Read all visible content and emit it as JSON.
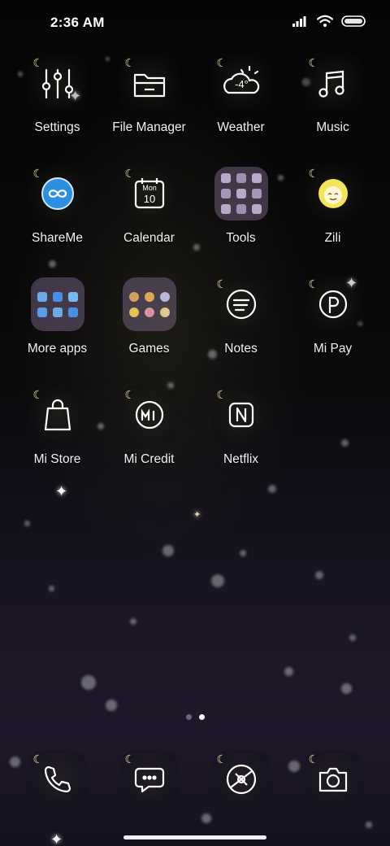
{
  "status_bar": {
    "time": "2:36 AM",
    "icons": [
      "signal-icon",
      "wifi-icon",
      "battery-icon"
    ]
  },
  "apps": [
    {
      "label": "Settings",
      "icon": "settings-sliders-icon"
    },
    {
      "label": "File Manager",
      "icon": "folder-icon"
    },
    {
      "label": "Weather",
      "icon": "weather-cloud-icon",
      "temp": "-4°"
    },
    {
      "label": "Music",
      "icon": "music-note-icon"
    },
    {
      "label": "ShareMe",
      "icon": "infinity-icon"
    },
    {
      "label": "Calendar",
      "icon": "calendar-icon",
      "day": "Mon",
      "date": "10"
    },
    {
      "label": "Tools",
      "icon": "folder-grid-icon"
    },
    {
      "label": "Zili",
      "icon": "zili-face-icon"
    },
    {
      "label": "More apps",
      "icon": "folder-grid-icon"
    },
    {
      "label": "Games",
      "icon": "folder-grid-icon"
    },
    {
      "label": "Notes",
      "icon": "notes-icon"
    },
    {
      "label": "Mi Pay",
      "icon": "mi-pay-icon"
    },
    {
      "label": "Mi Store",
      "icon": "shopping-bag-icon"
    },
    {
      "label": "Mi Credit",
      "icon": "mi-credit-icon"
    },
    {
      "label": "Netflix",
      "icon": "netflix-icon"
    }
  ],
  "pager": {
    "pages": 2,
    "current": 2
  },
  "dock": [
    {
      "icon": "phone-icon"
    },
    {
      "icon": "messages-icon"
    },
    {
      "icon": "browser-icon"
    },
    {
      "icon": "camera-icon"
    }
  ],
  "colors": {
    "icon_stroke": "#ffffff",
    "moon": "#f5e9a8",
    "shareme_blue": "#2d8fe0",
    "zili_yellow": "#f5e35a",
    "folder_tint": "#8a7aa0"
  }
}
